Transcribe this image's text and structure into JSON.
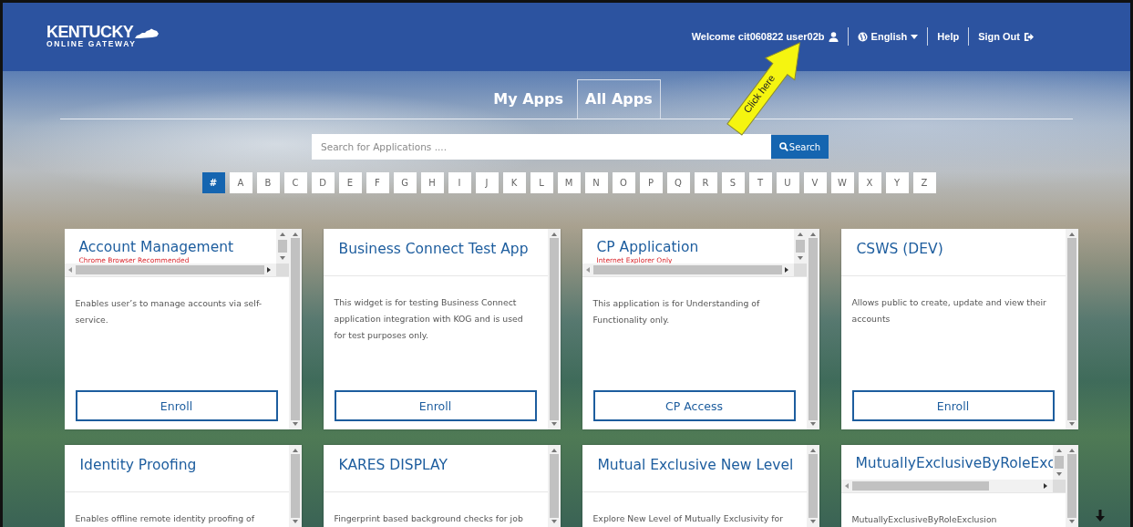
{
  "header": {
    "logo": {
      "line_1": "KENTUCKY",
      "line_2": "ONLINE GATEWAY"
    },
    "nav": [
      {
        "kind": "user",
        "label": "Welcome cit060822 user02b"
      },
      {
        "kind": "language",
        "label": "English"
      },
      {
        "kind": "link",
        "label": "Help"
      },
      {
        "kind": "signout",
        "label": "Sign Out"
      }
    ]
  },
  "callout": {
    "label": "Click here"
  },
  "tabs": [
    {
      "label": "My Apps",
      "selected": false
    },
    {
      "label": "All Apps",
      "selected": true
    }
  ],
  "search": {
    "placeholder": "Search for Applications ....",
    "button": "Search"
  },
  "letters": [
    {
      "label": "#",
      "selected": true
    },
    {
      "label": "A",
      "selected": false
    },
    {
      "label": "B",
      "selected": false
    },
    {
      "label": "C",
      "selected": false
    },
    {
      "label": "D",
      "selected": false
    },
    {
      "label": "E",
      "selected": false
    },
    {
      "label": "F",
      "selected": false
    },
    {
      "label": "G",
      "selected": false
    },
    {
      "label": "H",
      "selected": false
    },
    {
      "label": "I",
      "selected": false
    },
    {
      "label": "J",
      "selected": false
    },
    {
      "label": "K",
      "selected": false
    },
    {
      "label": "L",
      "selected": false
    },
    {
      "label": "M",
      "selected": false
    },
    {
      "label": "N",
      "selected": false
    },
    {
      "label": "O",
      "selected": false
    },
    {
      "label": "P",
      "selected": false
    },
    {
      "label": "Q",
      "selected": false
    },
    {
      "label": "R",
      "selected": false
    },
    {
      "label": "S",
      "selected": false
    },
    {
      "label": "T",
      "selected": false
    },
    {
      "label": "U",
      "selected": false
    },
    {
      "label": "V",
      "selected": false
    },
    {
      "label": "W",
      "selected": false
    },
    {
      "label": "X",
      "selected": false
    },
    {
      "label": "Y",
      "selected": false
    },
    {
      "label": "Z",
      "selected": false
    }
  ],
  "apps": [
    {
      "kind": "overflow",
      "title": "Account Management",
      "note": "Chrome Browser Recommended",
      "description": "Enables user’s to manage accounts via self-service.",
      "button": "Enroll"
    },
    {
      "kind": "plain",
      "title": "Business Connect Test App",
      "description": "This widget is for testing Business Connect application integration with KOG and is used for test purposes only.",
      "button": "Enroll"
    },
    {
      "kind": "overflow",
      "title": "CP Application",
      "note": "Internet Explorer Only",
      "description": "This application is for Understanding of Functionality only.",
      "button": "CP Access"
    },
    {
      "kind": "plain",
      "title": "CSWS (DEV)",
      "description": "Allows public to create, update and view their accounts",
      "button": "Enroll"
    },
    {
      "kind": "plain",
      "title": "Identity Proofing",
      "description": "Enables offline remote identity proofing of"
    },
    {
      "kind": "plain",
      "title": "KARES DISPLAY",
      "description": "Fingerprint based background checks for job"
    },
    {
      "kind": "plain",
      "title": "Mutual Exclusive New Level",
      "description": "Explore New Level of Mutually Exclusivity for"
    },
    {
      "kind": "overflow",
      "title": "MutuallyExclusiveByRoleExc",
      "description": "MutuallyExclusiveByRoleExclusion"
    }
  ]
}
